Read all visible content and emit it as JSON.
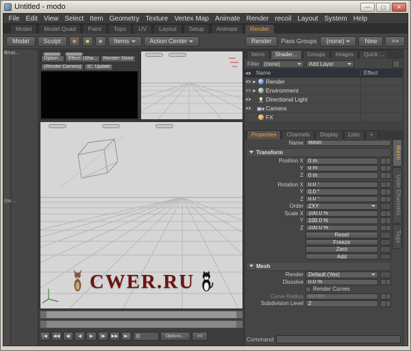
{
  "window": {
    "title": "Untitled - modo",
    "minimize": "—",
    "maximize": "▢",
    "close": "✕"
  },
  "menu": {
    "items": [
      "File",
      "Edit",
      "View",
      "Select",
      "Item",
      "Geometry",
      "Texture",
      "Vertex Map",
      "Animate",
      "Render",
      "recoil",
      "Layout",
      "System",
      "Help"
    ]
  },
  "layout_tabs": [
    "Model",
    "Model Quad",
    "Paint",
    "Topo",
    "UV",
    "Layout",
    "Setup",
    "Animate",
    "Render"
  ],
  "toolbar": {
    "model": "Model",
    "sculpt": "Sculpt",
    "icon1": "■",
    "icon2": "■",
    "icon3": "■",
    "items": "Items",
    "action_center": "Action Center",
    "render": "Render",
    "pass_groups": "Pass Groups",
    "pass_groups_value": "(none)",
    "new": "New",
    "overflow": ">>"
  },
  "left_strip": {
    "browser_tab": "Brow...",
    "collapsed_tab": "(no ..."
  },
  "preview": {
    "options": "Option...",
    "effect": "Effect: (Sha...",
    "status": "Render: Done",
    "camera": "(Render Camera)",
    "ic": "IC: Update"
  },
  "item_panel": {
    "tabs": [
      "Items",
      "Shader...",
      "Groups",
      "Images",
      "Quick ..."
    ],
    "filter_label": "Filter",
    "filter_value": "(none)",
    "add_layer": "Add Layer",
    "name_col": "Name",
    "effect_col": "Effect",
    "rows": [
      {
        "label": "Render",
        "icon": "render-sphere"
      },
      {
        "label": "Environment",
        "icon": "environment-sphere"
      },
      {
        "label": "Directional Light",
        "icon": "light"
      },
      {
        "label": "Camera",
        "icon": "camera"
      },
      {
        "label": "FX",
        "icon": "fx"
      }
    ]
  },
  "prop_tabs": [
    "Properties",
    "Channels",
    "Display",
    "Lists",
    "+"
  ],
  "props": {
    "name_label": "Name",
    "name_value": "Mesh",
    "transform": "Transform",
    "position": {
      "labels": [
        "Position X",
        "Y",
        "Z"
      ],
      "values": [
        "0 m",
        "0 m",
        "0 m"
      ]
    },
    "rotation": {
      "labels": [
        "Rotation X",
        "Y",
        "Z"
      ],
      "values": [
        "0.0 °",
        "0.0 °",
        "0.0 °"
      ]
    },
    "order": {
      "label": "Order",
      "value": "ZXY"
    },
    "scale": {
      "labels": [
        "Scale X",
        "Y",
        "Z"
      ],
      "values": [
        "100.0 %",
        "100.0 %",
        "100.0 %"
      ]
    },
    "actions": [
      "Reset",
      "Freeze",
      "Zero",
      "Add"
    ],
    "mesh_section": "Mesh",
    "render": {
      "label": "Render",
      "value": "Default (Yes)"
    },
    "dissolve": {
      "label": "Dissolve",
      "value": "0.0 %"
    },
    "render_curves": "Render Curves",
    "curve_radius": {
      "label": "Curve Radius",
      "value": "50 mm"
    },
    "subdivision": {
      "label": "Subdivision Level",
      "value": "2"
    }
  },
  "side_tabs": [
    "Mesh",
    "User Channels",
    "Tags"
  ],
  "transport": {
    "buttons": [
      "|◀",
      "◀◀",
      "◀|",
      "◀",
      "▶",
      "|▶",
      "▶▶",
      "▶|"
    ],
    "frame": "0",
    "options": "Options...",
    "overflow": ">>"
  },
  "command": {
    "label": "Command"
  },
  "viewport": {
    "watermark": "CWER.RU"
  },
  "colors": {
    "accent_orange": "#f0a339",
    "viewport_bg": "#d6d6d6",
    "panel_bg": "#454545",
    "watermark_red": "#6b1512"
  }
}
